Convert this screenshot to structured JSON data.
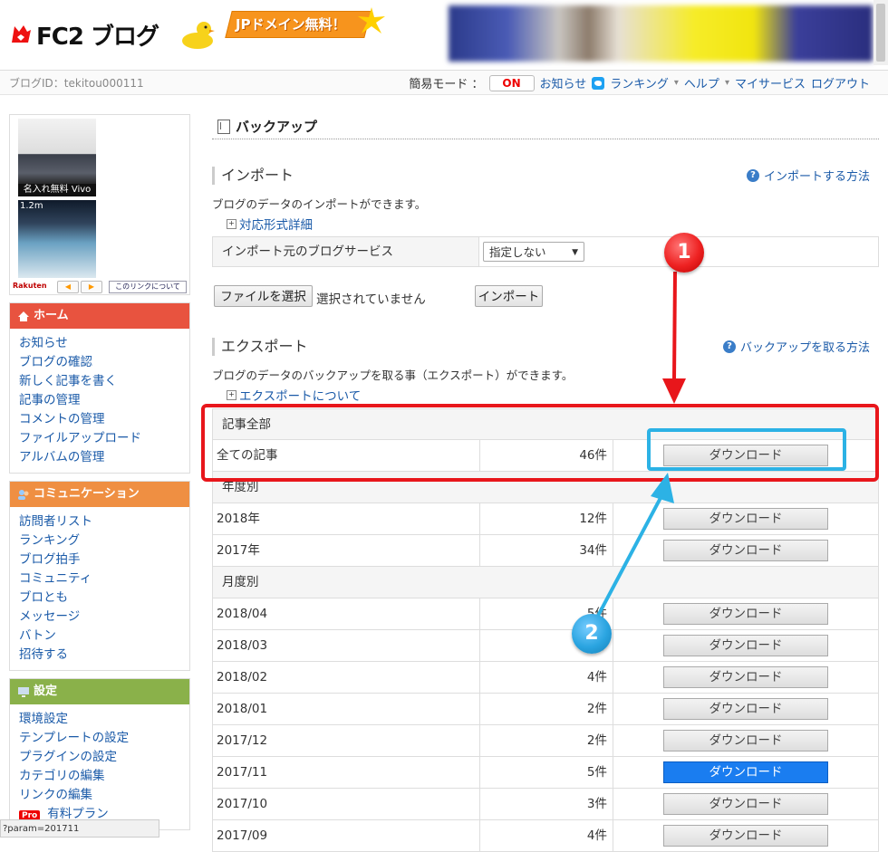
{
  "header": {
    "logo_text": "FC2 ブログ",
    "promo_text": "JPドメイン無料！"
  },
  "subbar": {
    "blog_id": "ブログID：tekitou000111",
    "mode_label": "簡易モード ：",
    "mode_value": "ON",
    "links": [
      "お知らせ",
      "ランキング",
      "ヘルプ",
      "マイサービス",
      "ログアウト"
    ]
  },
  "sidebar": {
    "ad": {
      "ad1_caption": "名入れ無料 Vivo",
      "ad2_caption": "1.2m",
      "rakuten": "Rakuten",
      "link_button": "このリンクについて"
    },
    "home": {
      "title": "ホーム",
      "items": [
        "お知らせ",
        "ブログの確認",
        "新しく記事を書く",
        "記事の管理",
        "コメントの管理",
        "ファイルアップロード",
        "アルバムの管理"
      ]
    },
    "communication": {
      "title": "コミュニケーション",
      "items": [
        "訪問者リスト",
        "ランキング",
        "ブログ拍手",
        "コミュニティ",
        "ブロとも",
        "メッセージ",
        "バトン",
        "招待する"
      ]
    },
    "settings": {
      "title": "設定",
      "items": [
        "環境設定",
        "テンプレートの設定",
        "プラグインの設定",
        "カテゴリの編集",
        "リンクの編集"
      ],
      "pro_badge": "Pro",
      "pro_label": "有料プラン"
    }
  },
  "status_url": "?param=201711",
  "main": {
    "page_title": "バックアップ",
    "import": {
      "heading": "インポート",
      "help": "インポートする方法",
      "desc": "ブログのデータのインポートができます。",
      "detail": "対応形式詳細",
      "service_label": "インポート元のブログサービス",
      "select_value": "指定しない",
      "file_button": "ファイルを選択",
      "file_status": "選択されていません",
      "import_button": "インポート"
    },
    "export": {
      "heading": "エクスポート",
      "help": "バックアップを取る方法",
      "desc": "ブログのデータのバックアップを取る事（エクスポート）ができます。",
      "detail": "エクスポートについて",
      "download_label": "ダウンロード",
      "group_all": "記事全部",
      "all_row": {
        "name": "全ての記事",
        "count": "46件"
      },
      "group_year": "年度別",
      "year_rows": [
        {
          "name": "2018年",
          "count": "12件"
        },
        {
          "name": "2017年",
          "count": "34件"
        }
      ],
      "group_month": "月度別",
      "month_rows": [
        {
          "name": "2018/04",
          "count": "5件"
        },
        {
          "name": "2018/03",
          "count": "4件"
        },
        {
          "name": "2018/02",
          "count": "4件"
        },
        {
          "name": "2018/01",
          "count": "2件"
        },
        {
          "name": "2017/12",
          "count": "2件"
        },
        {
          "name": "2017/11",
          "count": "5件"
        },
        {
          "name": "2017/10",
          "count": "3件"
        },
        {
          "name": "2017/09",
          "count": "4件"
        }
      ]
    }
  },
  "annotations": {
    "step1": "1",
    "step2": "2"
  },
  "colors": {
    "red": "#e8161b",
    "blue": "#2cb2e5",
    "active_button": "#1a7df0",
    "home_bar": "#e8533f",
    "comm_bar": "#ef8f42",
    "settings_bar": "#8ab14a"
  }
}
